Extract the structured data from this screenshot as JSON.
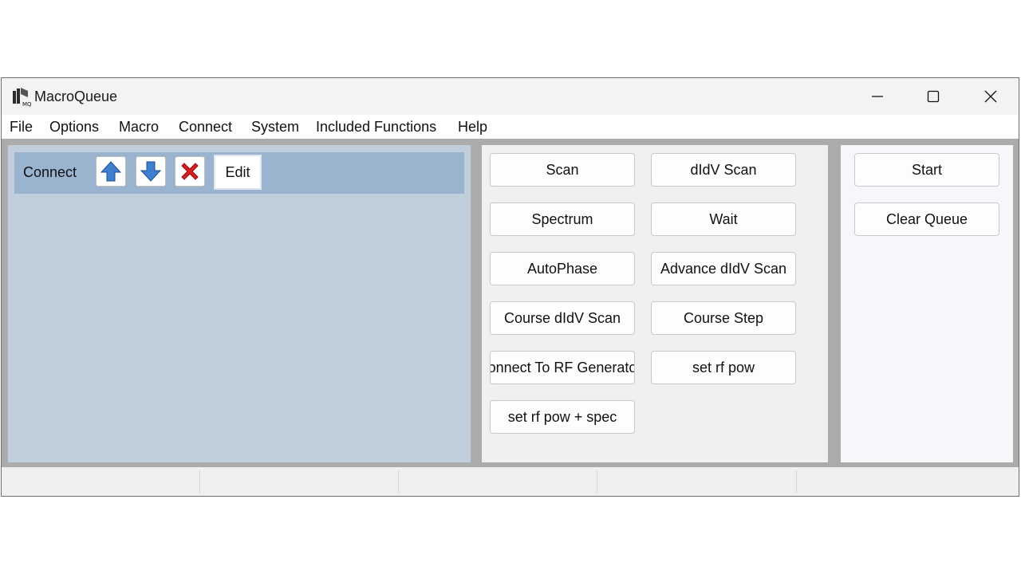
{
  "window": {
    "title": "MacroQueue"
  },
  "menu": {
    "items": [
      "File",
      "Options",
      "Macro",
      "Connect",
      "System",
      "Included Functions",
      "Help"
    ]
  },
  "queue": {
    "items": [
      {
        "label": "Connect",
        "edit_label": "Edit"
      }
    ]
  },
  "functions": {
    "buttons": [
      "Scan",
      "dIdV Scan",
      "Spectrum",
      "Wait",
      "AutoPhase",
      "Advance dIdV Scan",
      "Course dIdV Scan",
      "Course Step",
      "onnect To RF Generato",
      "set rf pow",
      "set rf pow + spec"
    ]
  },
  "controls": {
    "start_label": "Start",
    "clear_label": "Clear Queue"
  },
  "colors": {
    "queue_bg": "#c0cdda",
    "queue_item_bg": "#9ab3cf",
    "up_arrow": "#3f7fcf",
    "down_arrow": "#3f7fcf",
    "delete_x": "#d81e1e"
  },
  "icons": {
    "app": "macroqueue-logo-icon",
    "minimize": "minimize-icon",
    "maximize": "maximize-icon",
    "close": "close-icon",
    "move_up": "arrow-up-icon",
    "move_down": "arrow-down-icon",
    "remove": "delete-x-icon"
  }
}
